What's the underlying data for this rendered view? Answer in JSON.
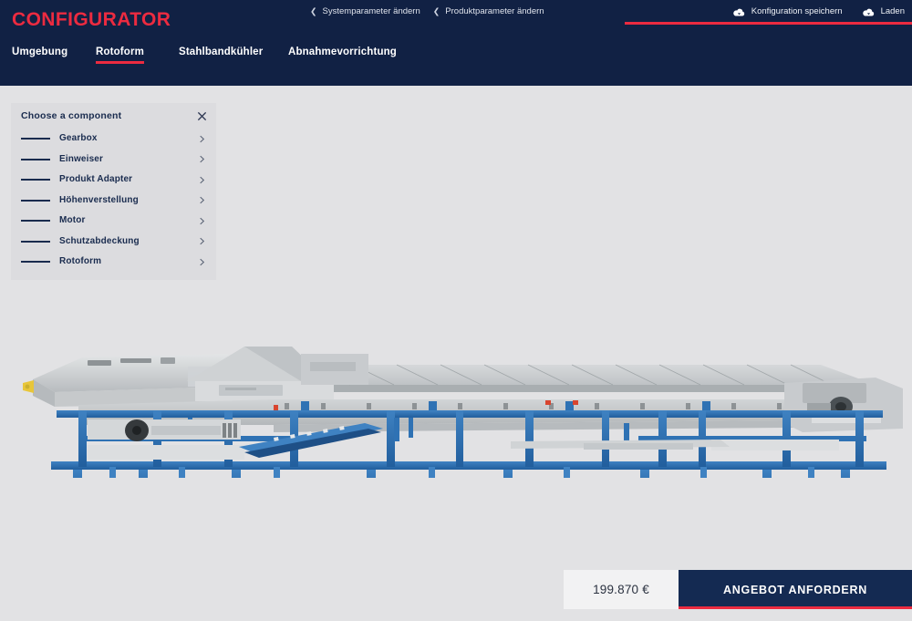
{
  "header": {
    "logo": "CONFIGURATOR",
    "breadcrumbs": [
      {
        "label": "Systemparameter ändern",
        "icon": "chevron-left-icon"
      },
      {
        "label": "Produktparameter ändern",
        "icon": "chevron-left-icon"
      }
    ],
    "actions": [
      {
        "label": "Konfiguration speichern",
        "icon": "cloud-upload-icon"
      },
      {
        "label": "Laden",
        "icon": "cloud-download-icon"
      }
    ],
    "accent_color": "#ec2b40",
    "background_color": "#112144"
  },
  "nav": {
    "tabs": [
      {
        "label": "Umgebung",
        "active": false
      },
      {
        "label": "Rotoform",
        "active": true
      },
      {
        "label": "Stahlbandkühler",
        "active": false
      },
      {
        "label": "Abnahmevorrichtung",
        "active": false
      }
    ]
  },
  "panel": {
    "title": "Choose a component",
    "close_icon": "close-icon",
    "items": [
      {
        "label": "Gearbox"
      },
      {
        "label": "Einweiser"
      },
      {
        "label": "Produkt Adapter"
      },
      {
        "label": "Höhenverstellung"
      },
      {
        "label": "Motor"
      },
      {
        "label": "Schutzabdeckung"
      },
      {
        "label": "Rotoform"
      }
    ],
    "row_icon": "chevron-right-icon",
    "background_color": "#dcdcdf"
  },
  "viewer": {
    "model_name": "steel-belt-cooler-machine",
    "frame_color": "#2f72b4",
    "body_color": "#c9ccce",
    "background_color": "#e2e2e4"
  },
  "footer": {
    "price": "199.870 €",
    "cta_label": "ANGEBOT ANFORDERN",
    "cta_color": "#142a52",
    "cta_accent": "#ec2b40"
  }
}
